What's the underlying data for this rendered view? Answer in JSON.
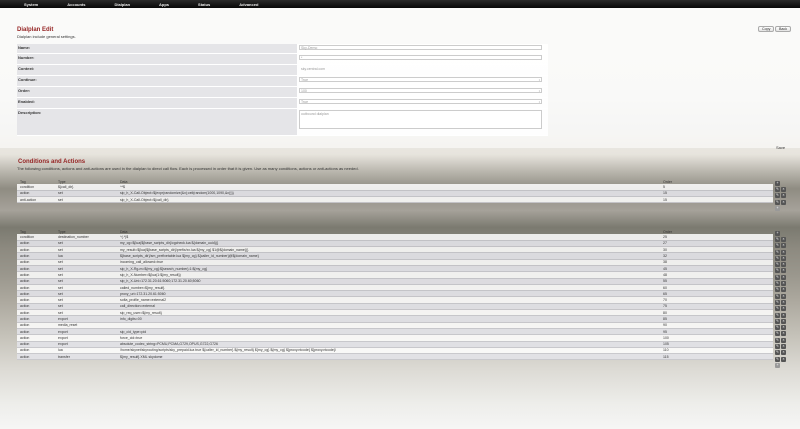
{
  "nav": {
    "items": [
      "System",
      "Accounts",
      "Dialplan",
      "Apps",
      "Status",
      "Advanced"
    ]
  },
  "page": {
    "title": "Dialplan Edit",
    "subtitle": "Dialplan include general settings."
  },
  "buttons": {
    "copy": "Copy",
    "back": "Back",
    "save": "Save"
  },
  "form": {
    "fields": [
      {
        "label": "Name:",
        "value": "Sky-Demo",
        "type": "text"
      },
      {
        "label": "Number:",
        "value": "*",
        "type": "text"
      },
      {
        "label": "Context:",
        "value": "sky.central.com",
        "type": "text"
      },
      {
        "label": "Continue:",
        "value": "True",
        "type": "select"
      },
      {
        "label": "Order:",
        "value": "100",
        "type": "select"
      },
      {
        "label": "Enabled:",
        "value": "True",
        "type": "select"
      },
      {
        "label": "Description:",
        "value": "outbound dialplan",
        "type": "textarea"
      }
    ]
  },
  "conditions": {
    "title": "Conditions and Actions",
    "description": "The following conditions, actions and anti-actions are used in the dialplan to direct call flow. Each is processed in order that it is given. Use as many conditions, actions or anti-actions as needed.",
    "headers": {
      "tag": "Tag",
      "type": "Type",
      "data": "Data",
      "order": "Order"
    },
    "group1": [
      {
        "tag": "condition",
        "type": "${call_dir}",
        "data": "^*$",
        "order": "5"
      },
      {
        "tag": "action",
        "type": "set",
        "data": "sip_h_X-Call-Object=${expr(randomize(&x);ceil(random(1000,1090,&x)))}",
        "order": "15"
      },
      {
        "tag": "anti-action",
        "type": "set",
        "data": "sip_h_X-Call-Object=${call_dir}",
        "order": "15"
      }
    ],
    "group2": [
      {
        "tag": "condition",
        "type": "destination_number",
        "data": "^(.*)$",
        "order": "25"
      },
      {
        "tag": "action",
        "type": "set",
        "data": "my_cg=${lua(${base_scripts_dir}/cgcheck.lua ${domain_uuid})}",
        "order": "27"
      },
      {
        "tag": "action",
        "type": "set",
        "data": "my_result=${lua(${base_scripts_dir}/prefix/xx.lua ${my_cg} $1@${domain_name})}",
        "order": "30"
      },
      {
        "tag": "action",
        "type": "lua",
        "data": "${base_scripts_dir}/sm_prefixetable.lua ${my_cg} ${caller_id_number}@${domain_name}",
        "order": "32"
      },
      {
        "tag": "action",
        "type": "set",
        "data": "incoming_call_allowed=true",
        "order": "38"
      },
      {
        "tag": "action",
        "type": "set",
        "data": "sip_h_X-Rg-m=${my_cg}:${search_number}:1:${my_cg}",
        "order": "45"
      },
      {
        "tag": "action",
        "type": "set",
        "data": "sip_h_X-Number=${lua(1:${my_result})",
        "order": "48"
      },
      {
        "tag": "action",
        "type": "set",
        "data": "sip_h_X-Uni=172.31.20.61:5060;172.31.20.60;5060",
        "order": "55"
      },
      {
        "tag": "action",
        "type": "set",
        "data": "called_number=${my_result}",
        "order": "60"
      },
      {
        "tag": "action",
        "type": "set",
        "data": "proxy_uri=172.31.20.61:5060",
        "order": "65"
      },
      {
        "tag": "action",
        "type": "set",
        "data": "sofia_profile_name=external2",
        "order": "70"
      },
      {
        "tag": "action",
        "type": "set",
        "data": "call_direction=external",
        "order": "75"
      },
      {
        "tag": "action",
        "type": "set",
        "data": "sip_req_user=${my_result}",
        "order": "80"
      },
      {
        "tag": "action",
        "type": "export",
        "data": "info_digits=00",
        "order": "85"
      },
      {
        "tag": "action",
        "type": "media_reset",
        "data": "",
        "order": "90"
      },
      {
        "tag": "action",
        "type": "export",
        "data": "sip_cid_type=pid",
        "order": "95"
      },
      {
        "tag": "action",
        "type": "export",
        "data": "force_cid=true",
        "order": "100"
      },
      {
        "tag": "action",
        "type": "export",
        "data": "absolute_codec_string=PCMU,PCMA,G729,OPUS,G722,G726",
        "order": "105"
      },
      {
        "tag": "action",
        "type": "lua",
        "data": "/home/skynet/skyrouting/scripts/sky_prepaid.lua true ${caller_id_number} ${my_result} ${my_cg} ${my_cg} ${proxy.ntcode} ${proxy.ntcode}/",
        "order": "110"
      },
      {
        "tag": "action",
        "type": "transfer",
        "data": "${my_result} XML skydome",
        "order": "115"
      }
    ]
  }
}
